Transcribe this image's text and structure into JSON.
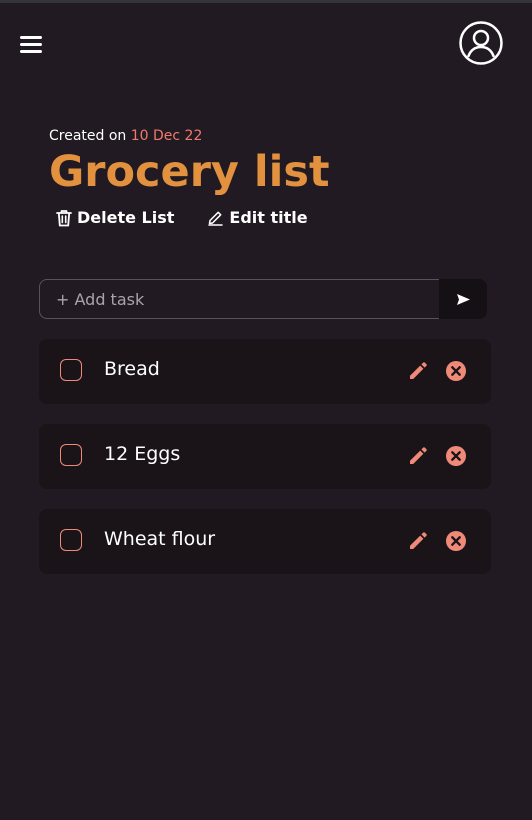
{
  "header": {
    "menu_icon": "hamburger-icon",
    "avatar_icon": "user-circle-icon"
  },
  "list": {
    "created_prefix": "Created on",
    "created_date": "10 Dec 22",
    "title": "Grocery list",
    "delete_label": "Delete List",
    "edit_label": "Edit title"
  },
  "add_task": {
    "placeholder": "+ Add task",
    "value": ""
  },
  "tasks": [
    {
      "label": "Bread",
      "done": false
    },
    {
      "label": "12 Eggs",
      "done": false
    },
    {
      "label": "Wheat flour",
      "done": false
    }
  ],
  "colors": {
    "background": "#221a22",
    "accent_title": "#e2913f",
    "accent_icons": "#f08a78",
    "date": "#f07a6a"
  }
}
